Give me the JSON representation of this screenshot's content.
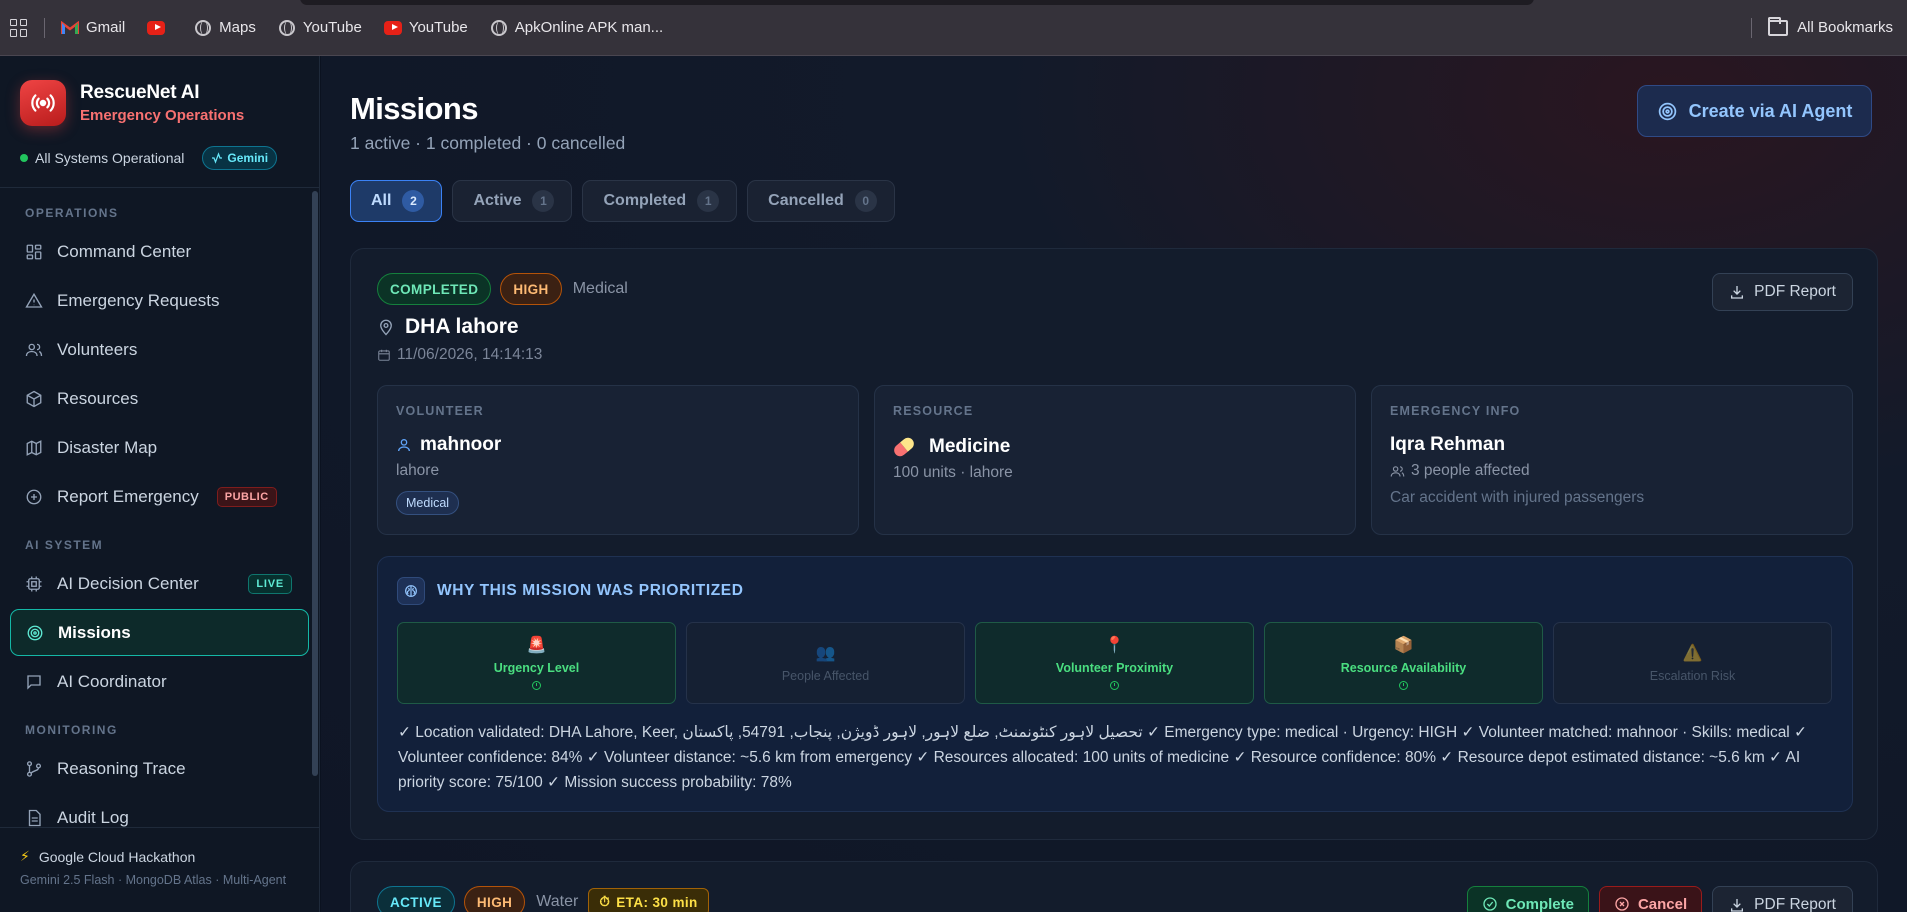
{
  "bookmarks": {
    "items": [
      {
        "label": "Gmail",
        "icon": "gmail-icon"
      },
      {
        "label": "",
        "icon": "youtube-icon"
      },
      {
        "label": "Maps",
        "icon": "globe-icon"
      },
      {
        "label": "YouTube",
        "icon": "globe-icon"
      },
      {
        "label": "YouTube",
        "icon": "youtube-icon"
      },
      {
        "label": "ApkOnline APK man...",
        "icon": "globe-icon"
      }
    ],
    "all_label": "All Bookmarks"
  },
  "sidebar": {
    "brand_title": "RescueNet AI",
    "brand_subtitle": "Emergency Operations",
    "status_text": "All Systems Operational",
    "gemini_badge": "Gemini",
    "sections": {
      "operations": "OPERATIONS",
      "ai_system": "AI SYSTEM",
      "monitoring": "MONITORING"
    },
    "nav": {
      "command_center": "Command Center",
      "emergency_requests": "Emergency Requests",
      "volunteers": "Volunteers",
      "resources": "Resources",
      "disaster_map": "Disaster Map",
      "report_emergency": "Report Emergency",
      "public_tag": "PUBLIC",
      "ai_decision_center": "AI Decision Center",
      "live_tag": "LIVE",
      "missions": "Missions",
      "ai_coordinator": "AI Coordinator",
      "reasoning_trace": "Reasoning Trace",
      "audit_log": "Audit Log"
    },
    "footer_title": "Google Cloud Hackathon",
    "footer_sub": "Gemini 2.5 Flash · MongoDB Atlas · Multi-Agent"
  },
  "main": {
    "title": "Missions",
    "subtitle": "1 active · 1 completed · 0 cancelled",
    "create_button": "Create via AI Agent",
    "filters": [
      {
        "label": "All",
        "count": "2"
      },
      {
        "label": "Active",
        "count": "1"
      },
      {
        "label": "Completed",
        "count": "1"
      },
      {
        "label": "Cancelled",
        "count": "0"
      }
    ]
  },
  "mission1": {
    "status": "COMPLETED",
    "priority": "HIGH",
    "category": "Medical",
    "pdf_button": "PDF Report",
    "location": "DHA lahore",
    "date": "11/06/2026, 14:14:13",
    "volunteer": {
      "label": "VOLUNTEER",
      "name": "mahnoor",
      "city": "lahore",
      "skill": "Medical"
    },
    "resource": {
      "label": "RESOURCE",
      "name": "Medicine",
      "detail": "100 units · lahore"
    },
    "emergency": {
      "label": "EMERGENCY INFO",
      "name": "Iqra Rehman",
      "affected": "3 people affected",
      "description": "Car accident with injured passengers"
    },
    "why_title": "WHY THIS MISSION WAS PRIORITIZED",
    "factors": [
      {
        "emoji": "🚨",
        "label": "Urgency Level",
        "active": true
      },
      {
        "emoji": "👥",
        "label": "People Affected",
        "active": false
      },
      {
        "emoji": "📍",
        "label": "Volunteer Proximity",
        "active": true
      },
      {
        "emoji": "📦",
        "label": "Resource Availability",
        "active": true
      },
      {
        "emoji": "⚠️",
        "label": "Escalation Risk",
        "active": false
      }
    ],
    "reasoning": "✓ Location validated: DHA Lahore, Keer, تحصیل لاہور کنٹونمنٹ, ضلع لاہور, لاہور ڈویژن, پنجاب, 54791, پاکستان ✓ Emergency type: medical · Urgency: HIGH ✓ Volunteer matched: mahnoor · Skills: medical ✓ Volunteer confidence: 84% ✓ Volunteer distance: ~5.6 km from emergency ✓ Resources allocated: 100 units of medicine ✓ Resource confidence: 80% ✓ Resource depot estimated distance: ~5.6 km ✓ AI priority score: 75/100 ✓ Mission success probability: 78%"
  },
  "mission2": {
    "status": "ACTIVE",
    "priority": "HIGH",
    "category": "Water",
    "eta": "ETA: 30 min",
    "complete_button": "Complete",
    "cancel_button": "Cancel",
    "pdf_button": "PDF Report"
  }
}
